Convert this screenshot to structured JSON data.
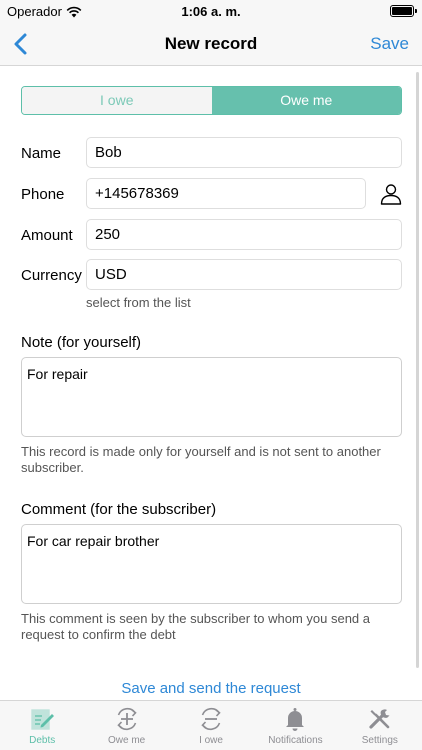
{
  "status": {
    "carrier": "Operador",
    "time": "1:06 a. m."
  },
  "nav": {
    "title": "New record",
    "save": "Save"
  },
  "segment": {
    "options": [
      "I owe",
      "Owe me"
    ],
    "selected": "Owe me"
  },
  "form": {
    "name_label": "Name",
    "name_value": "Bob",
    "phone_label": "Phone",
    "phone_value": "+145678369",
    "amount_label": "Amount",
    "amount_value": "250",
    "currency_label": "Currency",
    "currency_value": "USD",
    "currency_hint": "select from the list"
  },
  "note": {
    "title": "Note (for yourself)",
    "value": "For repair",
    "help": "This record is made only for yourself and is not sent to another subscriber."
  },
  "comment": {
    "title": "Comment (for the subscriber)",
    "value": "For car repair brother",
    "help": "This comment is seen by the subscriber to whom you send a request to confirm the debt"
  },
  "send_button": "Save and send the request",
  "tabs": [
    {
      "label": "Debts",
      "icon": "edit-doc-icon",
      "active": true
    },
    {
      "label": "Owe me",
      "icon": "plus-circle-icon",
      "active": false
    },
    {
      "label": "I owe",
      "icon": "minus-circle-icon",
      "active": false
    },
    {
      "label": "Notifications",
      "icon": "bell-icon",
      "active": false
    },
    {
      "label": "Settings",
      "icon": "tools-icon",
      "active": false
    }
  ],
  "colors": {
    "accent": "#2e88d6",
    "teal": "#66c0ad",
    "inactive": "#8e8e93"
  }
}
